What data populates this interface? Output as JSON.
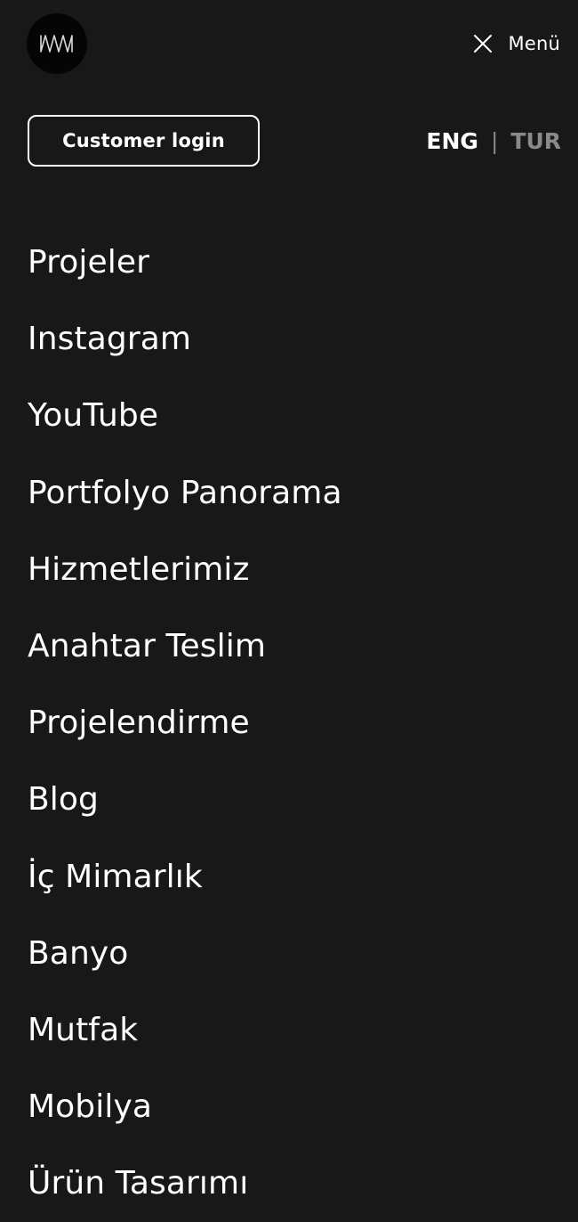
{
  "header": {
    "logo_icon": "brand-logo-icon",
    "menu_label": "Menü",
    "close_icon": "close-icon"
  },
  "account": {
    "customer_login_label": "Customer login"
  },
  "languages": {
    "eng": "ENG",
    "separator": "|",
    "tur": "TUR"
  },
  "nav": {
    "items": [
      {
        "label": "Projeler"
      },
      {
        "label": "Instagram"
      },
      {
        "label": "YouTube"
      },
      {
        "label": "Portfolyo Panorama"
      },
      {
        "label": "Hizmetlerimiz"
      },
      {
        "label": "Anahtar Teslim"
      },
      {
        "label": "Projelendirme"
      },
      {
        "label": "Blog"
      },
      {
        "label": "İç Mimarlık"
      },
      {
        "label": "Banyo"
      },
      {
        "label": "Mutfak"
      },
      {
        "label": "Mobilya"
      },
      {
        "label": "Ürün Tasarımı"
      }
    ]
  },
  "colors": {
    "background": "#181818",
    "text_primary": "#ffffff",
    "text_muted": "#8a8a8a",
    "logo_background": "#050505"
  }
}
